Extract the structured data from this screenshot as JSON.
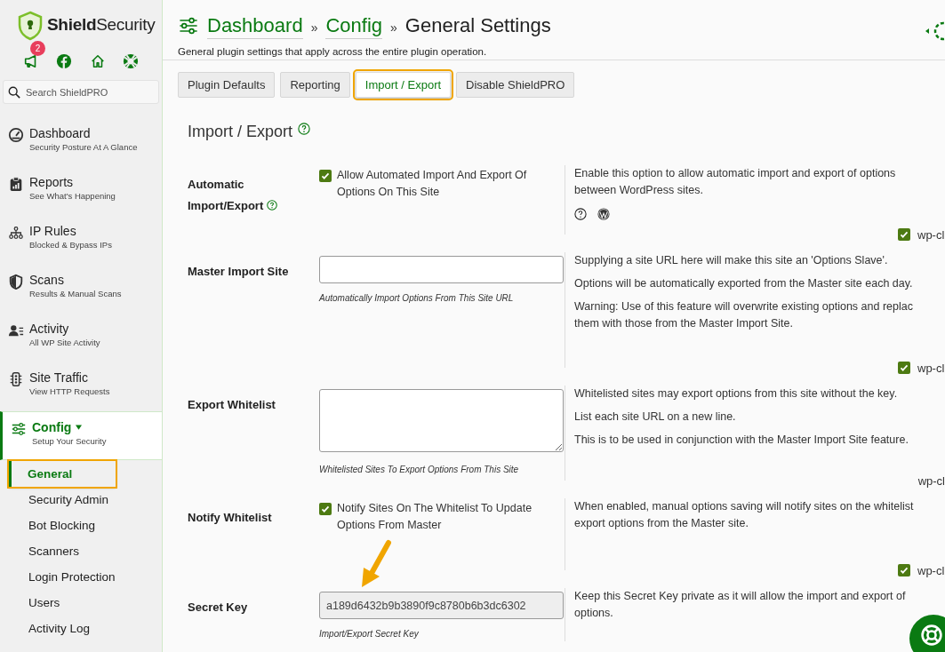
{
  "sidebar": {
    "logo": "**Shield**Security",
    "quick_links": [
      {
        "kind": "megaphone",
        "badge": "2"
      },
      {
        "kind": "facebook"
      },
      {
        "kind": "home"
      },
      {
        "kind": "lifebuoy"
      }
    ],
    "search": {
      "placeholder": "Search ShieldPRO"
    },
    "items": [
      {
        "kind": "gauge",
        "title": "Dashboard",
        "subtitle": "Security Posture At A Glance",
        "selected": false
      },
      {
        "kind": "clipboard",
        "title": "Reports",
        "subtitle": "See What's Happening",
        "selected": false
      },
      {
        "kind": "network",
        "title": "IP Rules",
        "subtitle": "Blocked & Bypass IPs",
        "selected": false
      },
      {
        "kind": "shield",
        "title": "Scans",
        "subtitle": "Results & Manual Scans",
        "selected": false
      },
      {
        "kind": "users",
        "title": "Activity",
        "subtitle": "All WP Site Activity",
        "selected": false
      },
      {
        "kind": "traffic",
        "title": "Site Traffic",
        "subtitle": "View HTTP Requests",
        "selected": false
      },
      {
        "kind": "sliders",
        "title": "Config",
        "subtitle": "Setup Your Security",
        "selected": true,
        "expanded": true,
        "children": [
          {
            "label": "General",
            "selected": true,
            "highlighted": true
          },
          {
            "label": "Security Admin",
            "selected": false,
            "highlighted": false
          },
          {
            "label": "Bot Blocking",
            "selected": false,
            "highlighted": false
          },
          {
            "label": "Scanners",
            "selected": false,
            "highlighted": false
          },
          {
            "label": "Login Protection",
            "selected": false,
            "highlighted": false
          },
          {
            "label": "Users",
            "selected": false,
            "highlighted": false
          },
          {
            "label": "Activity Log",
            "selected": false,
            "highlighted": false
          }
        ]
      }
    ]
  },
  "header": {
    "breadcrumbs": [
      {
        "label": "Dashboard",
        "kind": "link"
      },
      {
        "label": "Config",
        "kind": "link"
      },
      {
        "label": "General Settings",
        "kind": "current"
      }
    ],
    "separator": "»",
    "subtitle": "General plugin settings that apply across the entire plugin operation."
  },
  "tabs": [
    {
      "label": "Plugin Defaults",
      "selected": false,
      "highlighted": false
    },
    {
      "label": "Reporting",
      "selected": false,
      "highlighted": false
    },
    {
      "label": "Import / Export",
      "selected": true,
      "highlighted": true
    },
    {
      "label": "Disable ShieldPRO",
      "selected": false,
      "highlighted": false
    }
  ],
  "section": {
    "title": "Import / Export",
    "rows": [
      {
        "label": "Automatic Import/Export",
        "help": true,
        "kind": "checkbox",
        "checked": true,
        "option": "Allow Automated Import And Export Of Options On This Site",
        "description": [
          [
            "Enable this option to allow automatic import and export of options",
            "between WordPress sites."
          ]
        ],
        "doc_icons": true,
        "wp_cli": {
          "label": "wp-cl",
          "checkbox": true,
          "checked": true
        }
      },
      {
        "label": "Master Import Site",
        "help": false,
        "kind": "text",
        "value": "",
        "hint": "Automatically Import Options From This Site URL",
        "description": [
          [
            "Supplying a site URL here will make this site an 'Options Slave'."
          ],
          [
            "Options will be automatically exported from the Master site each day."
          ],
          [
            "Warning: Use of this feature will overwrite existing options and replac",
            "them with those from the Master Import Site."
          ]
        ],
        "doc_icons": false,
        "wp_cli": {
          "label": "wp-cl",
          "checkbox": true,
          "checked": true
        }
      },
      {
        "label": "Export Whitelist",
        "help": false,
        "kind": "textarea",
        "value": "",
        "hint": "Whitelisted Sites To Export Options From This Site",
        "description": [
          [
            "Whitelisted sites may export options from this site without the key."
          ],
          [
            "List each site URL on a new line."
          ],
          [
            "This is to be used in conjunction with the Master Import Site feature."
          ]
        ],
        "doc_icons": false,
        "wp_cli": {
          "label": "wp-cl",
          "checkbox": false
        }
      },
      {
        "label": "Notify Whitelist",
        "help": false,
        "kind": "checkbox",
        "checked": true,
        "option": "Notify Sites On The Whitelist To Update Options From Master",
        "description": [
          [
            "When enabled, manual options saving will notify sites on the whitelist",
            "export options from the Master site."
          ]
        ],
        "doc_icons": false,
        "wp_cli": {
          "label": "wp-cl",
          "checkbox": true,
          "checked": true
        }
      },
      {
        "label": "Secret Key",
        "help": false,
        "kind": "readonly",
        "value": "a189d6432b9b3890f9c8780b6b3dc6302",
        "hint": "Import/Export Secret Key",
        "description": [
          [
            "Keep this Secret Key private as it will allow the import and export of",
            "options."
          ]
        ],
        "doc_icons": false
      }
    ]
  }
}
